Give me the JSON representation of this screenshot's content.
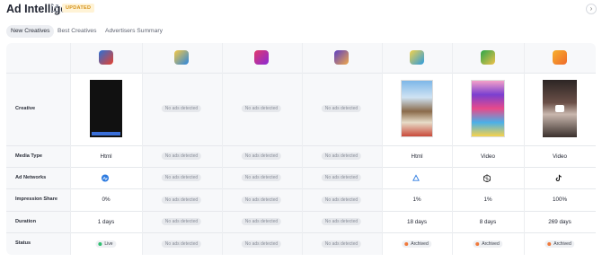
{
  "header": {
    "title": "Ad Intelligence",
    "badge": "UPDATED",
    "close": "›"
  },
  "tabs": [
    "New Creatives",
    "Best Creatives",
    "Advertisers Summary"
  ],
  "rows": {
    "creative": "Creative",
    "media_type": "Media Type",
    "ad_networks": "Ad Networks",
    "impression_share": "Impression Share",
    "duration": "Duration",
    "status": "Status"
  },
  "no_ads": "No ads detected",
  "apps": [
    {
      "icon": "app-icon-1",
      "color": "#e85a2c",
      "media_type": "Html",
      "network_icon": "meta-network-icon",
      "impression_share": "0%",
      "duration": "1 days",
      "status": "Live",
      "status_color": "#2fbf71"
    },
    {
      "icon": "app-icon-2",
      "color": "#f4b82e",
      "detected": false
    },
    {
      "icon": "app-icon-3",
      "color": "#d4366c",
      "detected": false
    },
    {
      "icon": "app-icon-4",
      "color": "#6a4fc7",
      "detected": false
    },
    {
      "icon": "app-icon-5",
      "color": "#3aa4d8",
      "media_type": "Html",
      "network_icon": "applovin-network-icon",
      "impression_share": "1%",
      "duration": "18 days",
      "status": "Archived",
      "status_color": "#f07a3c"
    },
    {
      "icon": "app-icon-6",
      "color": "#2aa64a",
      "media_type": "Video",
      "network_icon": "unity-network-icon",
      "impression_share": "1%",
      "duration": "8 days",
      "status": "Archived",
      "status_color": "#f07a3c"
    },
    {
      "icon": "app-icon-7",
      "color": "#f2903a",
      "media_type": "Video",
      "network_icon": "tiktok-network-icon",
      "impression_share": "100%",
      "duration": "269 days",
      "status": "Archived",
      "status_color": "#f07a3c"
    }
  ],
  "cols": {
    "c1": {
      "media_type": "Html",
      "impression_share": "0%",
      "duration": "1 days",
      "status": "Live"
    },
    "c5": {
      "media_type": "Html",
      "impression_share": "1%",
      "duration": "18 days",
      "status": "Archived"
    },
    "c6": {
      "media_type": "Video",
      "impression_share": "1%",
      "duration": "8 days",
      "status": "Archived"
    },
    "c7": {
      "media_type": "Video",
      "impression_share": "100%",
      "duration": "269 days",
      "status": "Archived"
    }
  }
}
